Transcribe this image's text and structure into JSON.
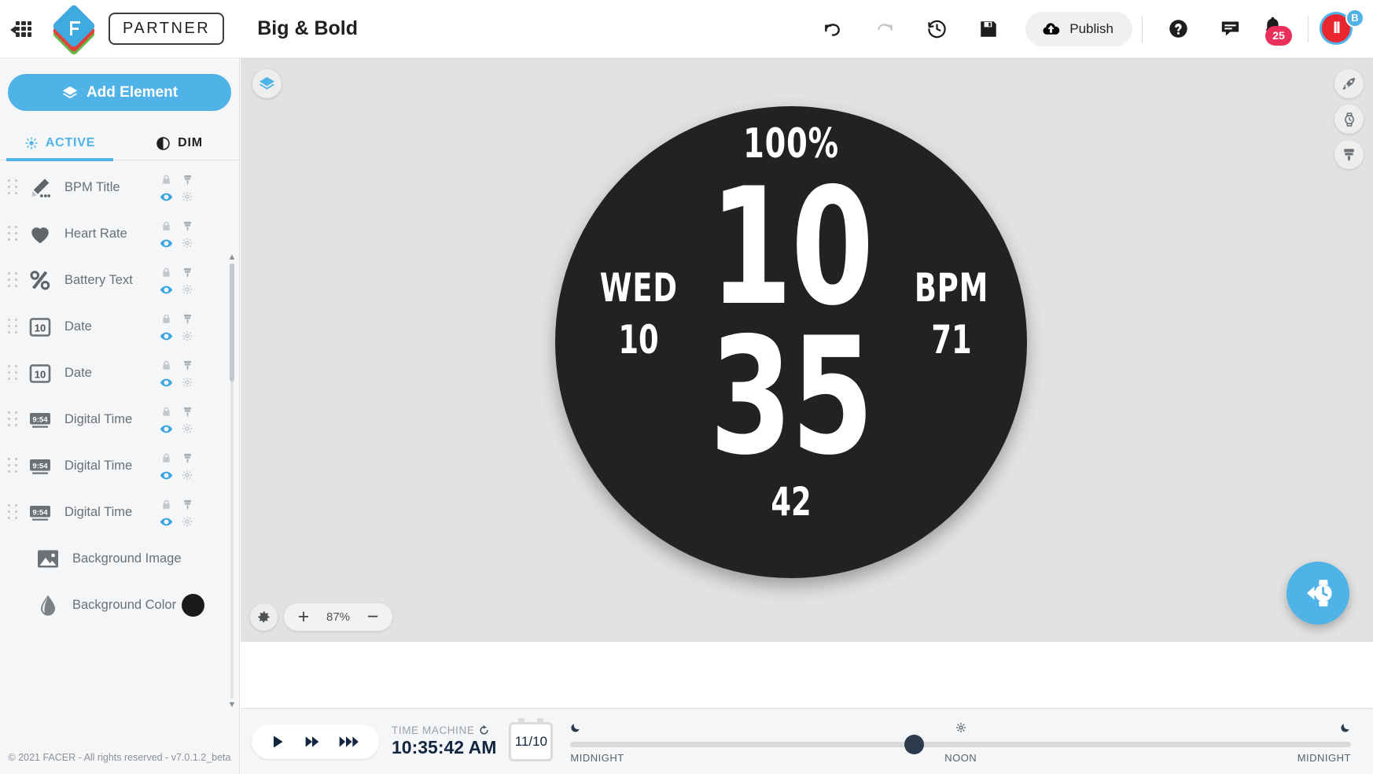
{
  "topbar": {
    "apps_icon": "apps-grid-icon",
    "brand": "PARTNER",
    "project_title": "Big & Bold",
    "undo_icon": "undo-icon",
    "redo_icon": "redo-icon",
    "history_icon": "history-icon",
    "save_icon": "save-icon",
    "publish_label": "Publish",
    "help_icon": "help-icon",
    "chat_icon": "chat-icon",
    "notification_count": "25",
    "avatar_badge": "B"
  },
  "sidebar": {
    "add_element_label": "Add Element",
    "tabs": [
      {
        "label": "ACTIVE",
        "icon": "sun-icon",
        "active": true
      },
      {
        "label": "DIM",
        "icon": "contrast-icon",
        "active": false
      }
    ],
    "layers": [
      {
        "name": "BPM Title",
        "icon": "pencil-icon",
        "has_controls": true
      },
      {
        "name": "Heart Rate",
        "icon": "heart-icon",
        "has_controls": true
      },
      {
        "name": "Battery Text",
        "icon": "percent-icon",
        "has_controls": true
      },
      {
        "name": "Date",
        "icon": "calendar-10-icon",
        "has_controls": true
      },
      {
        "name": "Date",
        "icon": "calendar-10-icon",
        "has_controls": true
      },
      {
        "name": "Digital Time",
        "icon": "digital-954-icon",
        "has_controls": true
      },
      {
        "name": "Digital Time",
        "icon": "digital-954-icon",
        "has_controls": true
      },
      {
        "name": "Digital Time",
        "icon": "digital-954-icon",
        "has_controls": true
      },
      {
        "name": "Background Image",
        "icon": "image-icon",
        "has_controls": false
      },
      {
        "name": "Background Color",
        "icon": "droplet-icon",
        "has_controls": false,
        "swatch": "#1b1b1b"
      }
    ],
    "layer_icon_badge_time": "9:54",
    "layer_icon_badge_date": "10",
    "footer": "© 2021 FACER - All rights reserved - v7.0.1.2_beta"
  },
  "canvas": {
    "layers_toggle_icon": "layers-icon",
    "right_tools": [
      {
        "icon": "rocket-icon",
        "name": "boost-tool"
      },
      {
        "icon": "watch-icon",
        "name": "watch-shape-tool"
      },
      {
        "icon": "brush-icon",
        "name": "theme-tool"
      }
    ],
    "zoom": {
      "gear_icon": "gear-icon",
      "plus": "+",
      "value": "87%",
      "minus": "−"
    },
    "send_to_watch_icon": "send-to-watch-icon"
  },
  "watchface": {
    "background_color": "#222222",
    "text_color": "#ffffff",
    "battery": "100%",
    "hour": "10",
    "minute": "35",
    "day_of_week": "WED",
    "day_of_month": "10",
    "bpm_label": "BPM",
    "bpm_value": "71",
    "seconds": "42"
  },
  "bottombar": {
    "play_icon": "play-icon",
    "fast_forward_icon": "fast-forward-icon",
    "faster_forward_icon": "faster-forward-icon",
    "time_machine_label": "TIME MACHINE",
    "reset_icon": "reset-icon",
    "current_time": "10:35:42 AM",
    "date_chip": "11/10",
    "timeline": {
      "left_label": "MIDNIGHT",
      "center_label": "NOON",
      "right_label": "MIDNIGHT",
      "left_icon": "moon-icon",
      "center_icon": "sun-icon",
      "right_icon": "moon-icon",
      "thumb_position_percent": 44
    }
  }
}
